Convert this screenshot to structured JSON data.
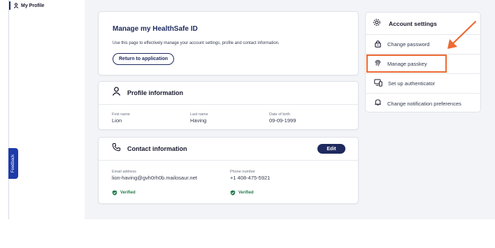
{
  "sidebar": {
    "item_label": "My Profile",
    "icon": "person-icon"
  },
  "feedback": {
    "label": "Feedback"
  },
  "manage": {
    "title": "Manage my HealthSafe ID",
    "description": "Use this page to effectively manage your account settings, profile and contact information.",
    "return_button": "Return to application"
  },
  "profile": {
    "title": "Profile information",
    "icon": "person-icon",
    "fields": [
      {
        "label": "First name",
        "value": "Lion"
      },
      {
        "label": "Last name",
        "value": "Having"
      },
      {
        "label": "Date of birth",
        "value": "09-09-1999"
      }
    ]
  },
  "contact": {
    "title": "Contact information",
    "icon": "phone-icon",
    "edit_button": "Edit",
    "email": {
      "label": "Email address",
      "value": "lion-having@gvh0rh0b.mailosaur.net",
      "status": "Verified"
    },
    "phone": {
      "label": "Phone number",
      "value": "+1 408-475-5921",
      "status": "Verified"
    }
  },
  "account_settings": {
    "title": "Account settings",
    "icon": "gear-icon",
    "items": [
      {
        "label": "Change password",
        "icon": "lock-icon"
      },
      {
        "label": "Manage passkey",
        "icon": "fingerprint-icon"
      },
      {
        "label": "Set up authenticator",
        "icon": "monitor-phone-icon"
      },
      {
        "label": "Change notification preferences",
        "icon": "bell-icon"
      }
    ]
  },
  "colors": {
    "brand_navy": "#1e2a5e",
    "feedback_blue": "#1e3ba8",
    "verified_green": "#237b4b",
    "annotation_orange": "#ee6a33",
    "background": "#f3f4f7"
  }
}
